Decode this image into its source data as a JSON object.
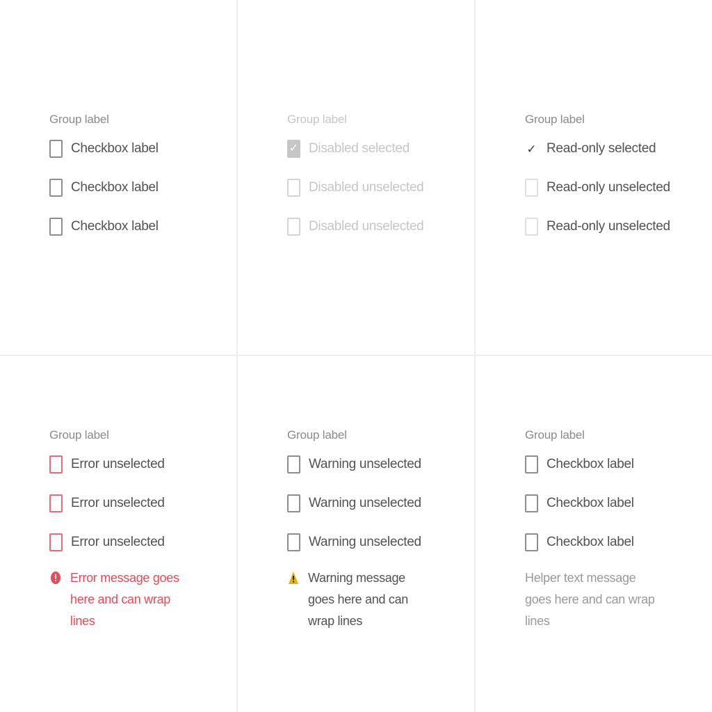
{
  "colors": {
    "error": "#e84b55",
    "warning": "#e3b400",
    "text": "#525252",
    "muted": "#8a8a8a",
    "disabled": "#c6c6c6"
  },
  "panels": {
    "default": {
      "group_label": "Group label",
      "items": [
        {
          "label": "Checkbox label",
          "checked": false
        },
        {
          "label": "Checkbox label",
          "checked": false
        },
        {
          "label": "Checkbox label",
          "checked": false
        }
      ]
    },
    "disabled": {
      "group_label": "Group label",
      "items": [
        {
          "label": "Disabled selected",
          "checked": true
        },
        {
          "label": "Disabled unselected",
          "checked": false
        },
        {
          "label": "Disabled unselected",
          "checked": false
        }
      ]
    },
    "readonly": {
      "group_label": "Group label",
      "items": [
        {
          "label": "Read-only selected",
          "checked": true
        },
        {
          "label": "Read-only unselected",
          "checked": false
        },
        {
          "label": "Read-only unselected",
          "checked": false
        }
      ]
    },
    "error": {
      "group_label": "Group label",
      "items": [
        {
          "label": "Error unselected",
          "checked": false
        },
        {
          "label": "Error unselected",
          "checked": false
        },
        {
          "label": "Error unselected",
          "checked": false
        }
      ],
      "message": "Error message goes here and can wrap lines",
      "icon": "error-filled-icon"
    },
    "warning": {
      "group_label": "Group label",
      "items": [
        {
          "label": "Warning unselected",
          "checked": false
        },
        {
          "label": "Warning unselected",
          "checked": false
        },
        {
          "label": "Warning unselected",
          "checked": false
        }
      ],
      "message": "Warning message goes here and can wrap lines",
      "icon": "warning-filled-icon"
    },
    "helper": {
      "group_label": "Group label",
      "items": [
        {
          "label": "Checkbox label",
          "checked": false
        },
        {
          "label": "Checkbox label",
          "checked": false
        },
        {
          "label": "Checkbox label",
          "checked": false
        }
      ],
      "helper_text": "Helper text message goes here and can wrap lines"
    }
  }
}
